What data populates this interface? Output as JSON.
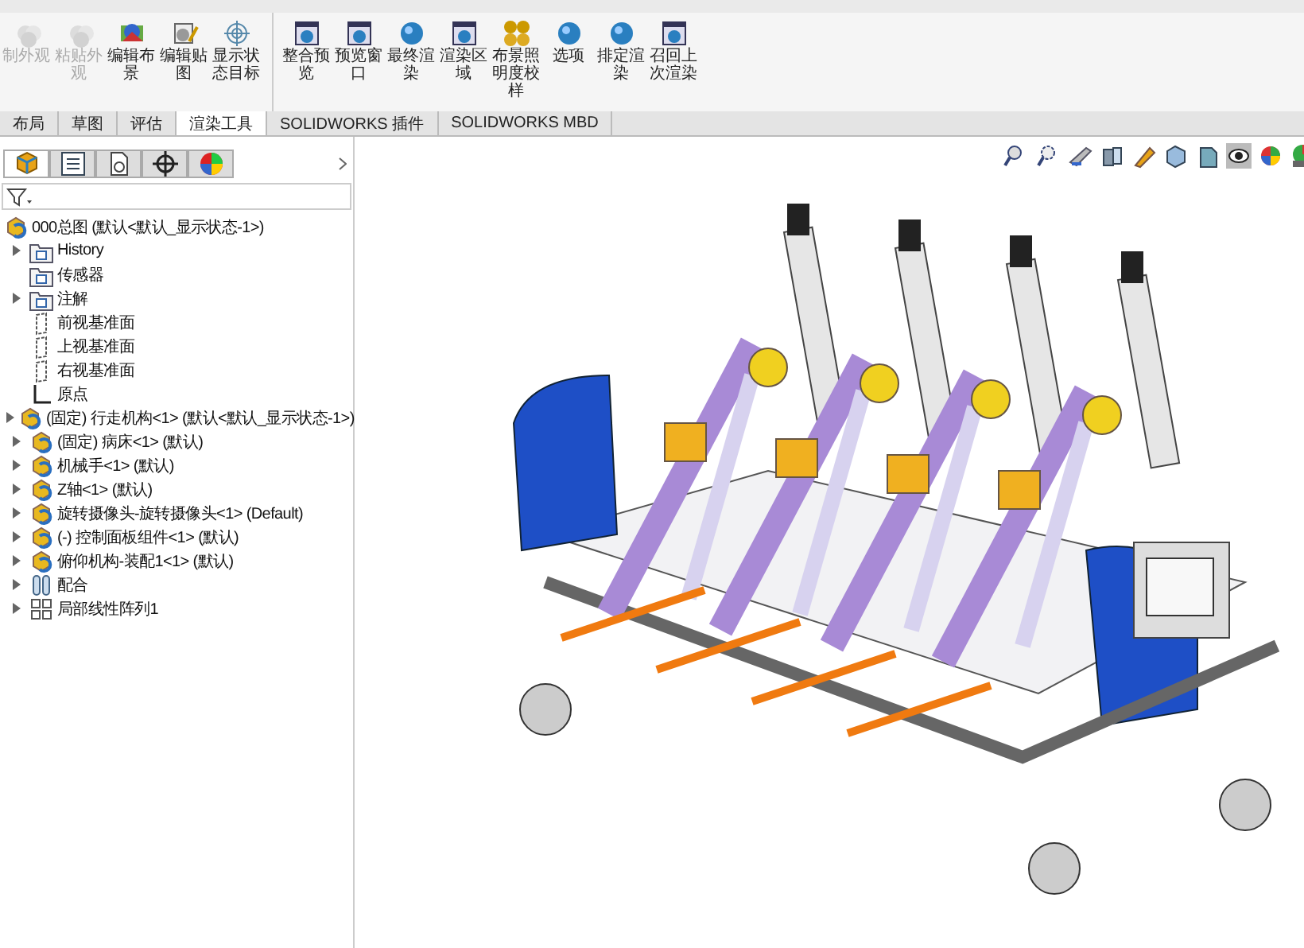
{
  "ribbon": {
    "groups": [
      [
        {
          "label": "制外观",
          "kind": "spheres",
          "disabled": true
        },
        {
          "label": "粘贴外观",
          "kind": "spheres",
          "disabled": true
        },
        {
          "label": "编辑布景",
          "kind": "scene",
          "disabled": false
        },
        {
          "label": "编辑贴图",
          "kind": "decal",
          "disabled": false
        },
        {
          "label": "显示状态目标",
          "kind": "target",
          "disabled": false
        }
      ],
      [
        {
          "label": "整合预览",
          "kind": "window",
          "disabled": false
        },
        {
          "label": "预览窗口",
          "kind": "window",
          "disabled": false
        },
        {
          "label": "最终渲染",
          "kind": "sphere",
          "disabled": false
        },
        {
          "label": "渲染区域",
          "kind": "window",
          "disabled": false
        },
        {
          "label": "布景照明度校样",
          "kind": "bulbs",
          "disabled": false
        },
        {
          "label": "选项",
          "kind": "sphere",
          "disabled": false
        },
        {
          "label": "排定渲染",
          "kind": "sphere",
          "disabled": false
        },
        {
          "label": "召回上次渲染",
          "kind": "window",
          "disabled": false
        }
      ]
    ]
  },
  "tabs": [
    {
      "label": "布局",
      "selected": false
    },
    {
      "label": "草图",
      "selected": false
    },
    {
      "label": "评估",
      "selected": false
    },
    {
      "label": "渲染工具",
      "selected": true
    },
    {
      "label": "SOLIDWORKS 插件",
      "selected": false
    },
    {
      "label": "SOLIDWORKS MBD",
      "selected": false
    }
  ],
  "panel_tabs": [
    {
      "kind": "feature",
      "selected": true
    },
    {
      "kind": "property",
      "selected": false
    },
    {
      "kind": "config",
      "selected": false
    },
    {
      "kind": "dimxpert",
      "selected": false
    },
    {
      "kind": "display",
      "selected": false
    }
  ],
  "tree": {
    "root": "000总图  (默认<默认_显示状态-1>)",
    "items": [
      {
        "label": "History",
        "kind": "folder",
        "expandable": true
      },
      {
        "label": "传感器",
        "kind": "folder",
        "expandable": false
      },
      {
        "label": "注解",
        "kind": "folder",
        "expandable": true
      },
      {
        "label": "前视基准面",
        "kind": "plane",
        "expandable": false
      },
      {
        "label": "上视基准面",
        "kind": "plane",
        "expandable": false
      },
      {
        "label": "右视基准面",
        "kind": "plane",
        "expandable": false
      },
      {
        "label": "原点",
        "kind": "origin",
        "expandable": false
      },
      {
        "label": "(固定) 行走机构<1> (默认<默认_显示状态-1>)",
        "kind": "assembly",
        "expandable": true
      },
      {
        "label": "(固定) 病床<1> (默认)",
        "kind": "assembly",
        "expandable": true
      },
      {
        "label": "机械手<1> (默认)",
        "kind": "assembly",
        "expandable": true
      },
      {
        "label": "Z轴<1> (默认)",
        "kind": "assembly",
        "expandable": true
      },
      {
        "label": "旋转摄像头-旋转摄像头<1> (Default)",
        "kind": "assembly",
        "expandable": true
      },
      {
        "label": "(-) 控制面板组件<1> (默认)",
        "kind": "assembly",
        "expandable": true
      },
      {
        "label": "俯仰机构-装配1<1> (默认)",
        "kind": "assembly",
        "expandable": true
      },
      {
        "label": "配合",
        "kind": "mates",
        "expandable": true
      },
      {
        "label": "局部线性阵列1",
        "kind": "pattern",
        "expandable": true
      }
    ]
  }
}
